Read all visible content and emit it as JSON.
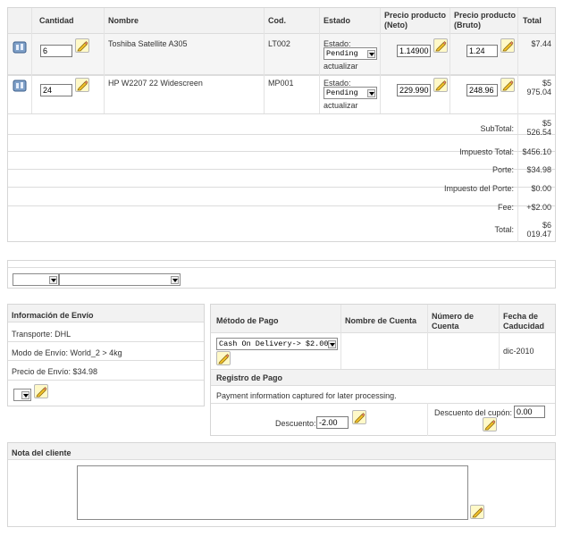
{
  "order_table": {
    "headers": {
      "quantity": "Cantidad",
      "name": "Nombre",
      "code": "Cod.",
      "state": "Estado",
      "price_net": [
        "Precio producto",
        "(Neto)"
      ],
      "price_gross": [
        "Precio producto",
        "(Bruto)"
      ],
      "total": "Total"
    },
    "items": [
      {
        "quantity": "6",
        "name": "Toshiba Satellite A305",
        "code": "LT002",
        "state_label": "Estado:",
        "state_value": "Pending",
        "update": "actualizar",
        "price_net": "1.14900",
        "price_gross": "1.24",
        "total": [
          "$7.44"
        ]
      },
      {
        "quantity": "24",
        "name": "HP W2207 22 Widescreen",
        "code": "MP001",
        "state_label": "Estado:",
        "state_value": "Pending",
        "update": "actualizar",
        "price_net": "229.990",
        "price_gross": "248.96",
        "total": [
          "$5",
          "975.04"
        ]
      }
    ],
    "summary": [
      {
        "label": "SubTotal:",
        "value": [
          "$5",
          "526.54"
        ]
      },
      {
        "label": "Impuesto Total:",
        "value": [
          "$456.10"
        ]
      },
      {
        "label": "Porte:",
        "value": [
          "$34.98"
        ]
      },
      {
        "label": "Impuesto del Porte:",
        "value": [
          "$0.00"
        ]
      },
      {
        "label": "Fee:",
        "value": [
          "+$2.00"
        ]
      },
      {
        "label": "Total:",
        "value": [
          "$6",
          "019.47"
        ]
      }
    ]
  },
  "shipping": {
    "title": "Información de Envío",
    "carrier": "Transporte: DHL",
    "mode": "Modo de Envío: World_2 > 4kg",
    "price": "Precio de Envío: $34.98"
  },
  "payment": {
    "headers": {
      "method": "Método de Pago",
      "account_name": "Nombre de Cuenta",
      "account_number": [
        "Número de",
        "Cuenta"
      ],
      "expiry": [
        "Fecha de",
        "Caducidad"
      ]
    },
    "method_value": "Cash On Delivery-> $2.00",
    "expiry_value": "dic-2010",
    "log_title": "Registro de Pago",
    "log_text": "Payment information captured for later processing.",
    "discount_label": "Descuento:",
    "discount_value": "-2.00",
    "coupon_label": "Descuento del cupón:",
    "coupon_value": "0.00"
  },
  "customer_note": {
    "title": "Nota del cliente",
    "value": ""
  }
}
